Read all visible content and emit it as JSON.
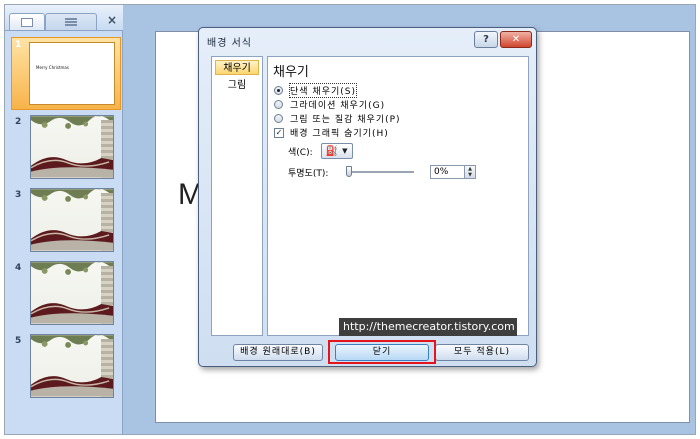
{
  "slide_pane": {
    "tabs": [
      {
        "name": "slides-tab"
      },
      {
        "name": "outline-tab"
      }
    ],
    "close_glyph": "×",
    "slides": [
      {
        "number": "1",
        "title": "Merry Christmas",
        "selected": true
      },
      {
        "number": "2"
      },
      {
        "number": "3"
      },
      {
        "number": "4"
      },
      {
        "number": "5"
      }
    ]
  },
  "canvas": {
    "partial_title": "M"
  },
  "dialog": {
    "title": "배경 서식",
    "help_glyph": "?",
    "close_glyph": "✕",
    "nav": [
      {
        "label": "채우기",
        "selected": true
      },
      {
        "label": "그림",
        "selected": false
      }
    ],
    "panel": {
      "heading": "채우기",
      "options": {
        "solid": "단색 채우기(S)",
        "gradient": "그라데이션 채우기(G)",
        "picture": "그림 또는 질감 채우기(P)",
        "hide_graphics": "배경 그래픽 숨기기(H)"
      },
      "selected_option": "solid",
      "hide_graphics_checked": true,
      "color_label": "색(C):",
      "transparency_label": "투명도(T):",
      "transparency_value": "0%",
      "transparency_fraction": 0
    },
    "buttons": {
      "reset": "배경 원래대로(B)",
      "close": "닫기",
      "apply_all": "모두 적용(L)"
    }
  },
  "watermark": "http://themecreator.tistory.com",
  "colors": {
    "highlight_border": "#e4141b",
    "selected_slide": "#f8b34a",
    "frame_bg": "#a9c3e3"
  }
}
